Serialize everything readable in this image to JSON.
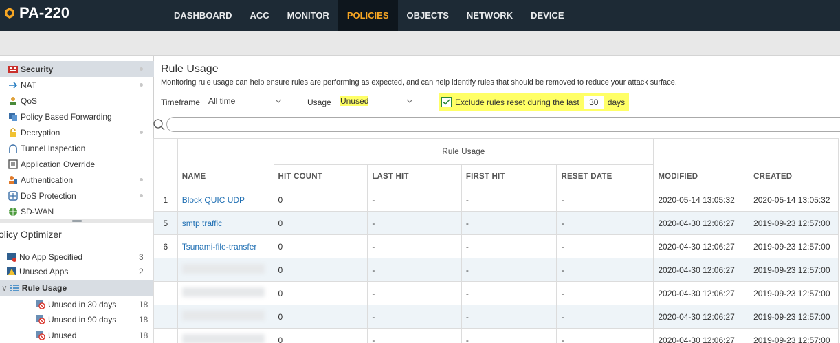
{
  "brand": {
    "name": "PA-220"
  },
  "nav": [
    {
      "label": "DASHBOARD",
      "active": false
    },
    {
      "label": "ACC",
      "active": false
    },
    {
      "label": "MONITOR",
      "active": false
    },
    {
      "label": "POLICIES",
      "active": true
    },
    {
      "label": "OBJECTS",
      "active": false
    },
    {
      "label": "NETWORK",
      "active": false
    },
    {
      "label": "DEVICE",
      "active": false
    }
  ],
  "sidebar": {
    "items": [
      {
        "label": "Security",
        "icon": "security-policy-icon",
        "selected": true
      },
      {
        "label": "NAT",
        "icon": "nat-arrow-icon"
      },
      {
        "label": "QoS",
        "icon": "qos-icon"
      },
      {
        "label": "Policy Based Forwarding",
        "icon": "pbf-icon"
      },
      {
        "label": "Decryption",
        "icon": "decryption-lock-icon"
      },
      {
        "label": "Tunnel Inspection",
        "icon": "tunnel-icon"
      },
      {
        "label": "Application Override",
        "icon": "app-override-icon"
      },
      {
        "label": "Authentication",
        "icon": "authentication-icon"
      },
      {
        "label": "DoS Protection",
        "icon": "dos-shield-icon"
      },
      {
        "label": "SD-WAN",
        "icon": "sd-wan-globe-icon"
      }
    ],
    "optimizer": {
      "title": "olicy Optimizer",
      "items": [
        {
          "label": "No App Specified",
          "count": "3"
        },
        {
          "label": "Unused Apps",
          "count": "2"
        },
        {
          "label": "Rule Usage",
          "count": ""
        },
        {
          "label": "Unused in 30 days",
          "count": "18"
        },
        {
          "label": "Unused in 90 days",
          "count": "18"
        },
        {
          "label": "Unused",
          "count": "18"
        }
      ]
    }
  },
  "main": {
    "title": "Rule Usage",
    "description": "Monitoring rule usage can help ensure rules are performing as expected, and can help identify rules that should be removed to reduce your attack surface.",
    "timeframe_label": "Timeframe",
    "timeframe_value": "All time",
    "usage_label": "Usage",
    "usage_value": "Unused",
    "exclude_label": "Exclude rules reset during the last",
    "exclude_checked": true,
    "exclude_days": "30",
    "days_label": "days"
  },
  "table": {
    "group_header": "Rule Usage",
    "columns": [
      "NAME",
      "HIT COUNT",
      "LAST HIT",
      "FIRST HIT",
      "RESET DATE",
      "MODIFIED",
      "CREATED"
    ],
    "rows": [
      {
        "num": "1",
        "name": "Block QUIC UDP",
        "hit": "0",
        "last": "-",
        "first": "-",
        "reset": "-",
        "modified": "2020-05-14 13:05:32",
        "created": "2020-05-14 13:05:32"
      },
      {
        "num": "5",
        "name": "smtp traffic",
        "hit": "0",
        "last": "-",
        "first": "-",
        "reset": "-",
        "modified": "2020-04-30 12:06:27",
        "created": "2019-09-23 12:57:00"
      },
      {
        "num": "6",
        "name": "Tsunami-file-transfer",
        "hit": "0",
        "last": "-",
        "first": "-",
        "reset": "-",
        "modified": "2020-04-30 12:06:27",
        "created": "2019-09-23 12:57:00"
      },
      {
        "num": "",
        "name": "",
        "hit": "0",
        "last": "-",
        "first": "-",
        "reset": "-",
        "modified": "2020-04-30 12:06:27",
        "created": "2019-09-23 12:57:00"
      },
      {
        "num": "",
        "name": "",
        "hit": "0",
        "last": "-",
        "first": "-",
        "reset": "-",
        "modified": "2020-04-30 12:06:27",
        "created": "2019-09-23 12:57:00"
      },
      {
        "num": "",
        "name": "",
        "hit": "0",
        "last": "-",
        "first": "-",
        "reset": "-",
        "modified": "2020-04-30 12:06:27",
        "created": "2019-09-23 12:57:00"
      },
      {
        "num": "",
        "name": "",
        "hit": "0",
        "last": "-",
        "first": "-",
        "reset": "-",
        "modified": "2020-04-30 12:06:27",
        "created": "2019-09-23 12:57:00"
      }
    ]
  },
  "colors": {
    "nav_bg": "#1d2a35",
    "active_nav": "#f7a623",
    "highlight": "#ffff66",
    "link": "#1f6fb3"
  }
}
